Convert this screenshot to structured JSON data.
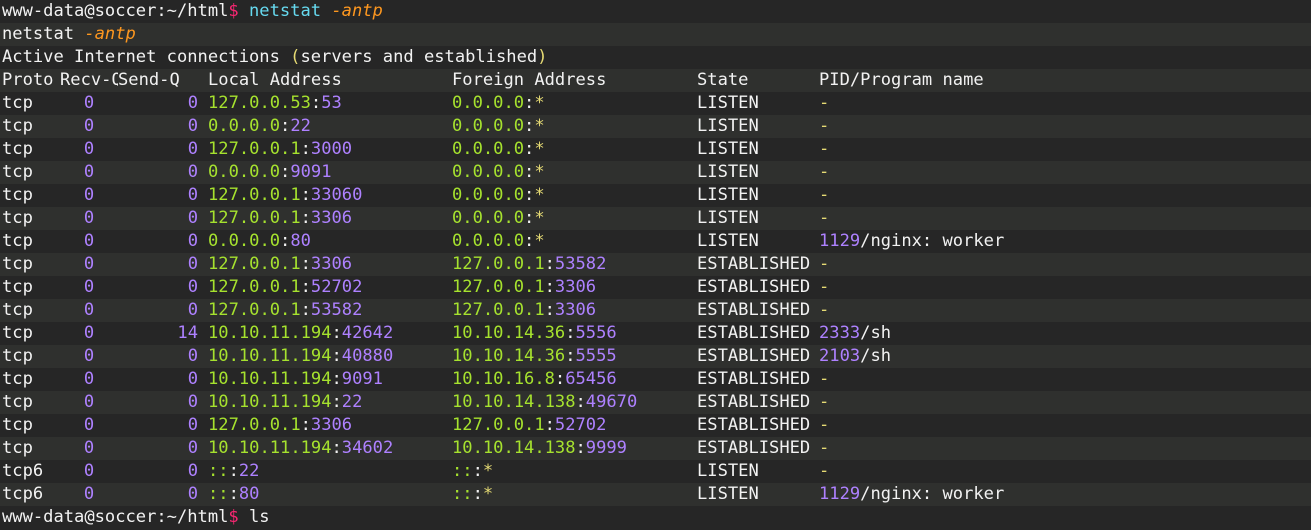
{
  "colors": {
    "background": "#262626",
    "alt_row": "#2f302e",
    "text": "#f2f2f2",
    "prompt_symbol": "#f92672",
    "command": "#66d9ef",
    "flag": "#fd971f",
    "address_ip": "#a6e22e",
    "number": "#ae81ff",
    "dash": "#e6db74"
  },
  "prompt": {
    "user_host_path": "www-data@soccer:~/html",
    "symbol": "$",
    "command": "netstat",
    "args": "-antp"
  },
  "echo": {
    "command": "netstat",
    "args": "-antp"
  },
  "header": {
    "title_pre": "Active Internet connections ",
    "title_paren_open": "(",
    "title_inner": "servers and established",
    "title_paren_close": ")",
    "columns": [
      "Proto",
      "Recv-Q",
      "Send-Q",
      "Local Address",
      "Foreign Address",
      "State",
      "PID/Program name"
    ]
  },
  "rows": [
    {
      "proto": "tcp",
      "recvq": "0",
      "sendq": "0",
      "local_ip": "127.0.0.53",
      "local_port": "53",
      "foreign_ip": "0.0.0.0",
      "foreign_port": "*",
      "state": "LISTEN",
      "pid": "",
      "program": "-"
    },
    {
      "proto": "tcp",
      "recvq": "0",
      "sendq": "0",
      "local_ip": "0.0.0.0",
      "local_port": "22",
      "foreign_ip": "0.0.0.0",
      "foreign_port": "*",
      "state": "LISTEN",
      "pid": "",
      "program": "-"
    },
    {
      "proto": "tcp",
      "recvq": "0",
      "sendq": "0",
      "local_ip": "127.0.0.1",
      "local_port": "3000",
      "foreign_ip": "0.0.0.0",
      "foreign_port": "*",
      "state": "LISTEN",
      "pid": "",
      "program": "-"
    },
    {
      "proto": "tcp",
      "recvq": "0",
      "sendq": "0",
      "local_ip": "0.0.0.0",
      "local_port": "9091",
      "foreign_ip": "0.0.0.0",
      "foreign_port": "*",
      "state": "LISTEN",
      "pid": "",
      "program": "-"
    },
    {
      "proto": "tcp",
      "recvq": "0",
      "sendq": "0",
      "local_ip": "127.0.0.1",
      "local_port": "33060",
      "foreign_ip": "0.0.0.0",
      "foreign_port": "*",
      "state": "LISTEN",
      "pid": "",
      "program": "-"
    },
    {
      "proto": "tcp",
      "recvq": "0",
      "sendq": "0",
      "local_ip": "127.0.0.1",
      "local_port": "3306",
      "foreign_ip": "0.0.0.0",
      "foreign_port": "*",
      "state": "LISTEN",
      "pid": "",
      "program": "-"
    },
    {
      "proto": "tcp",
      "recvq": "0",
      "sendq": "0",
      "local_ip": "0.0.0.0",
      "local_port": "80",
      "foreign_ip": "0.0.0.0",
      "foreign_port": "*",
      "state": "LISTEN",
      "pid": "1129",
      "program": "/nginx: worker"
    },
    {
      "proto": "tcp",
      "recvq": "0",
      "sendq": "0",
      "local_ip": "127.0.0.1",
      "local_port": "3306",
      "foreign_ip": "127.0.0.1",
      "foreign_port": "53582",
      "state": "ESTABLISHED",
      "pid": "",
      "program": "-"
    },
    {
      "proto": "tcp",
      "recvq": "0",
      "sendq": "0",
      "local_ip": "127.0.0.1",
      "local_port": "52702",
      "foreign_ip": "127.0.0.1",
      "foreign_port": "3306",
      "state": "ESTABLISHED",
      "pid": "",
      "program": "-"
    },
    {
      "proto": "tcp",
      "recvq": "0",
      "sendq": "0",
      "local_ip": "127.0.0.1",
      "local_port": "53582",
      "foreign_ip": "127.0.0.1",
      "foreign_port": "3306",
      "state": "ESTABLISHED",
      "pid": "",
      "program": "-"
    },
    {
      "proto": "tcp",
      "recvq": "0",
      "sendq": "14",
      "local_ip": "10.10.11.194",
      "local_port": "42642",
      "foreign_ip": "10.10.14.36",
      "foreign_port": "5556",
      "state": "ESTABLISHED",
      "pid": "2333",
      "program": "/sh"
    },
    {
      "proto": "tcp",
      "recvq": "0",
      "sendq": "0",
      "local_ip": "10.10.11.194",
      "local_port": "40880",
      "foreign_ip": "10.10.14.36",
      "foreign_port": "5555",
      "state": "ESTABLISHED",
      "pid": "2103",
      "program": "/sh"
    },
    {
      "proto": "tcp",
      "recvq": "0",
      "sendq": "0",
      "local_ip": "10.10.11.194",
      "local_port": "9091",
      "foreign_ip": "10.10.16.8",
      "foreign_port": "65456",
      "state": "ESTABLISHED",
      "pid": "",
      "program": "-"
    },
    {
      "proto": "tcp",
      "recvq": "0",
      "sendq": "0",
      "local_ip": "10.10.11.194",
      "local_port": "22",
      "foreign_ip": "10.10.14.138",
      "foreign_port": "49670",
      "state": "ESTABLISHED",
      "pid": "",
      "program": "-"
    },
    {
      "proto": "tcp",
      "recvq": "0",
      "sendq": "0",
      "local_ip": "127.0.0.1",
      "local_port": "3306",
      "foreign_ip": "127.0.0.1",
      "foreign_port": "52702",
      "state": "ESTABLISHED",
      "pid": "",
      "program": "-"
    },
    {
      "proto": "tcp",
      "recvq": "0",
      "sendq": "0",
      "local_ip": "10.10.11.194",
      "local_port": "34602",
      "foreign_ip": "10.10.14.138",
      "foreign_port": "9999",
      "state": "ESTABLISHED",
      "pid": "",
      "program": "-"
    },
    {
      "proto": "tcp6",
      "recvq": "0",
      "sendq": "0",
      "local_ip": "::",
      "local_port": "22",
      "foreign_ip": "::",
      "foreign_port": "*",
      "state": "LISTEN",
      "pid": "",
      "program": "-"
    },
    {
      "proto": "tcp6",
      "recvq": "0",
      "sendq": "0",
      "local_ip": "::",
      "local_port": "80",
      "foreign_ip": "::",
      "foreign_port": "*",
      "state": "LISTEN",
      "pid": "1129",
      "program": "/nginx: worker"
    }
  ],
  "final_prompt": {
    "user_host_path": "www-data@soccer:~/html",
    "symbol": "$",
    "command": "ls"
  }
}
